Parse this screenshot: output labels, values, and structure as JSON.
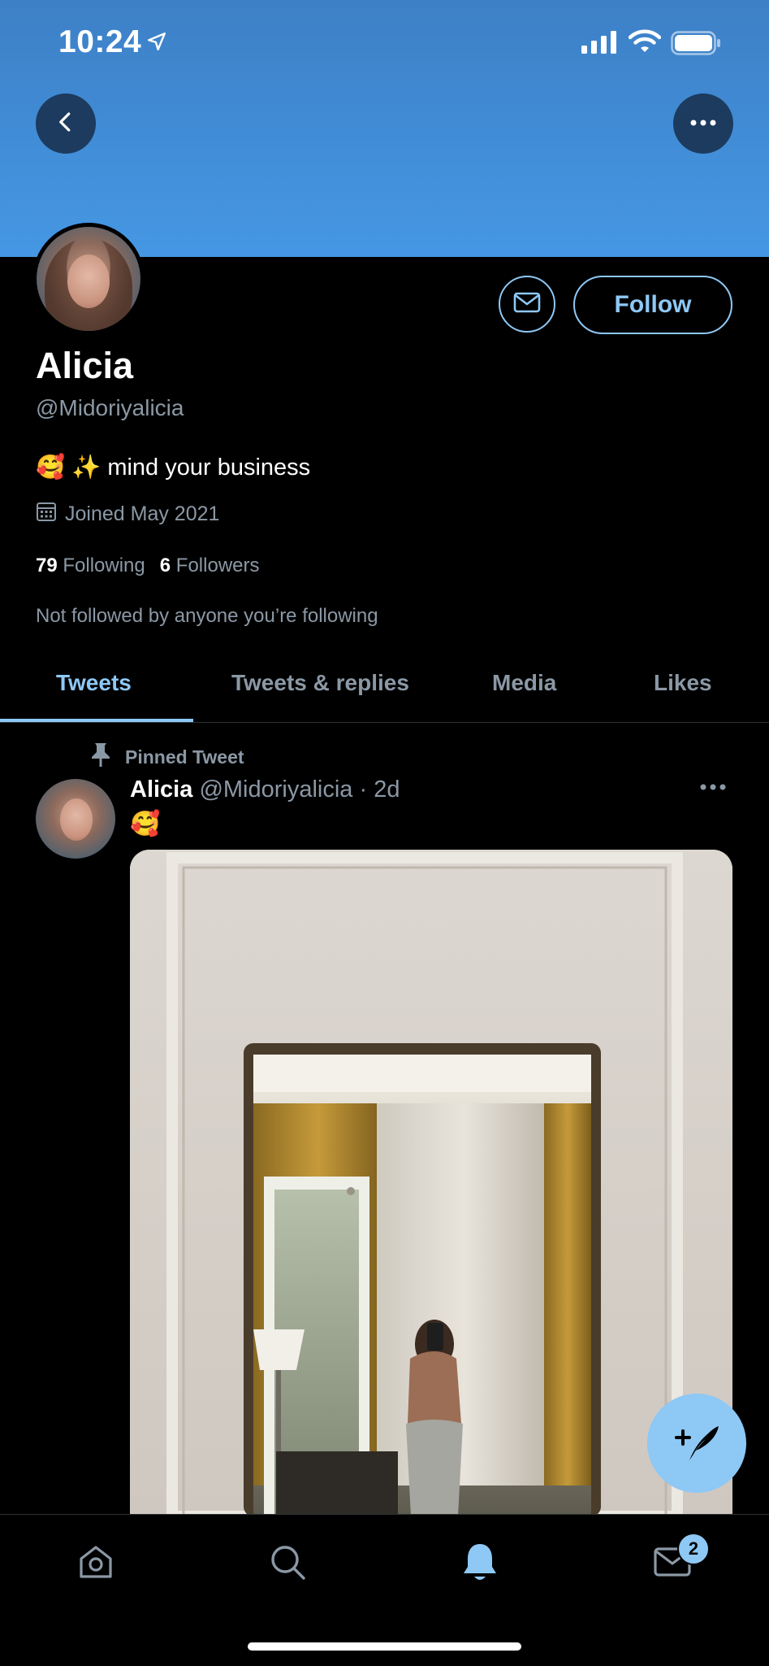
{
  "status_bar": {
    "time": "10:24"
  },
  "header": {
    "back_icon": "chevron-left-icon",
    "more_icon": "ellipsis-icon"
  },
  "profile": {
    "name": "Alicia",
    "handle": "@Midoriyalicia",
    "bio": "🥰 ✨ mind your business",
    "joined": "Joined May 2021",
    "following_count": "79",
    "following_label": "Following",
    "followers_count": "6",
    "followers_label": "Followers",
    "not_followed": "Not followed by anyone you’re following",
    "follow_label": "Follow"
  },
  "tabs": [
    {
      "label": "Tweets",
      "active": true
    },
    {
      "label": "Tweets & replies",
      "active": false
    },
    {
      "label": "Media",
      "active": false
    },
    {
      "label": "Likes",
      "active": false
    }
  ],
  "tweet": {
    "pinned_label": "Pinned Tweet",
    "author_name": "Alicia",
    "author_meta": "@Midoriyalicia · 2d",
    "text": "🥰"
  },
  "bottom_nav": {
    "items": [
      "home-icon",
      "search-icon",
      "notifications-icon",
      "messages-icon"
    ],
    "messages_badge": "2"
  },
  "colors": {
    "accent": "#8ec8f5",
    "banner": "#4597e4",
    "muted": "#8b98a5"
  }
}
